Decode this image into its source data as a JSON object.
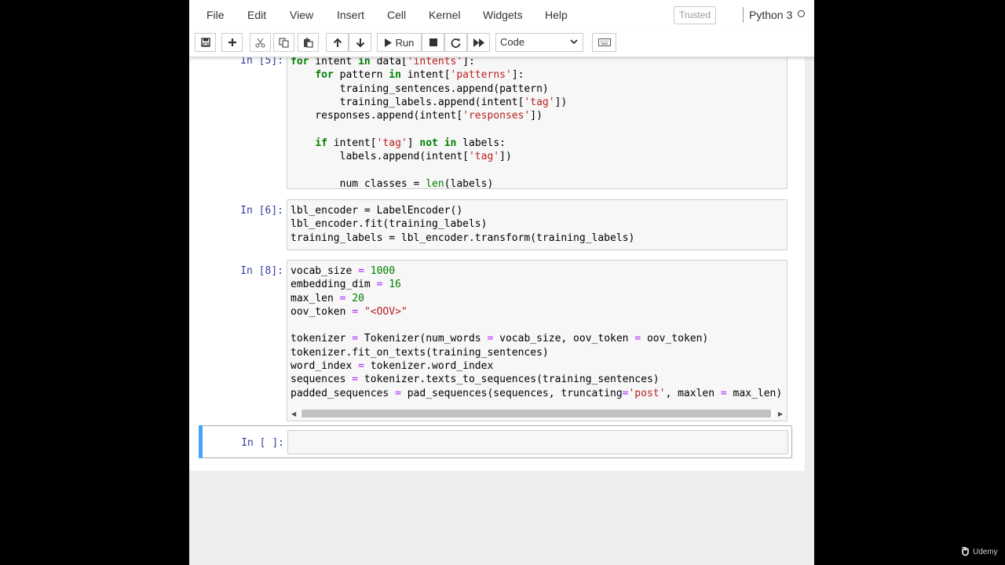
{
  "menu": {
    "items": [
      "File",
      "Edit",
      "View",
      "Insert",
      "Cell",
      "Kernel",
      "Widgets",
      "Help"
    ],
    "trusted_label": "Trusted",
    "kernel_name": "Python 3"
  },
  "toolbar": {
    "run_label": "Run",
    "cell_type_value": "Code",
    "cell_type_options": [
      "Code"
    ],
    "icons": [
      "save-icon",
      "plus-icon",
      "cut-icon",
      "copy-icon",
      "paste-icon",
      "arrow-up-icon",
      "arrow-down-icon",
      "run-icon",
      "stop-icon",
      "restart-icon",
      "fast-forward-icon",
      "keyboard-icon"
    ]
  },
  "cells": [
    {
      "prompt": "In [5]:",
      "lines": [
        "for intent in data['intents']:",
        "    for pattern in intent['patterns']:",
        "        training_sentences.append(pattern)",
        "        training_labels.append(intent['tag'])",
        "    responses.append(intent['responses'])",
        "",
        "    if intent['tag'] not in labels:",
        "        labels.append(intent['tag'])",
        "",
        "        num_classes = len(labels)"
      ]
    },
    {
      "prompt": "In [6]:",
      "lines": [
        "lbl_encoder = LabelEncoder()",
        "lbl_encoder.fit(training_labels)",
        "training_labels = lbl_encoder.transform(training_labels)"
      ]
    },
    {
      "prompt": "In [8]:",
      "lines": [
        "vocab_size = 1000",
        "embedding_dim = 16",
        "max_len = 20",
        "oov_token = \"<OOV>\"",
        "",
        "tokenizer = Tokenizer(num_words = vocab_size, oov_token = oov_token)",
        "tokenizer.fit_on_texts(training_sentences)",
        "word_index = tokenizer.word_index",
        "sequences = tokenizer.texts_to_sequences(training_sentences)",
        "padded_sequences = pad_sequences(sequences, truncating='post', maxlen = max_len)"
      ]
    },
    {
      "prompt": "In [ ]:",
      "lines": []
    }
  ],
  "watermark": "Udemy",
  "colors": {
    "accent_selected": "#42a5f5",
    "prompt": "#303f9f",
    "keyword": "#008000",
    "string": "#ba2121",
    "operator": "#aa22ff"
  }
}
